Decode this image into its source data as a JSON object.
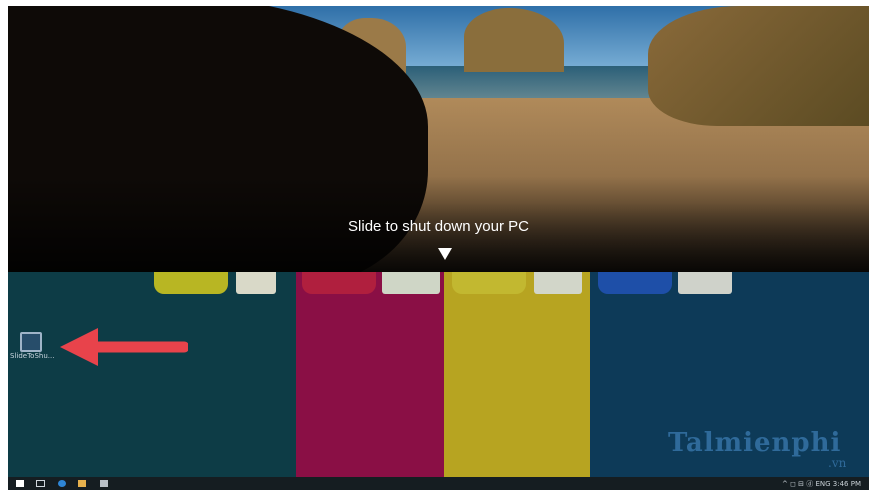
{
  "slide_prompt": {
    "text": "Slide to shut down your PC"
  },
  "desktop": {
    "shortcut_label": "SlideToShu..."
  },
  "watermark": {
    "brand": "Talmienphi",
    "domain": ".vn"
  },
  "taskbar": {
    "tray_text": "^  ◻  ⊟  ⓓ  ENG  3:46 PM"
  },
  "colors": {
    "arrow": "#e8434b",
    "band_red": "#8a0f45",
    "band_yellow": "#b7a421",
    "band_blue": "#0d3a58"
  },
  "icons": [
    "windows-start-icon",
    "search-icon",
    "edge-icon",
    "file-explorer-icon",
    "store-icon",
    "shortcut-icon",
    "down-arrow-icon"
  ]
}
